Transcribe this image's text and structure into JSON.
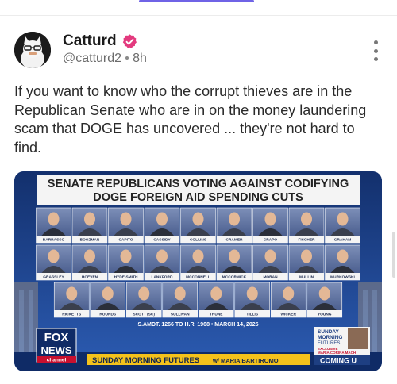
{
  "post": {
    "author_name": "Catturd",
    "handle": "@catturd2",
    "time": "8h",
    "text": "If you want to know who the corrupt thieves are in the Republican Senate who are in on the money laundering scam that DOGE has uncovered ... they're not hard to find."
  },
  "media": {
    "headline_line1": "SENATE REPUBLICANS VOTING AGAINST CODIFYING",
    "headline_line2": "DOGE FOREIGN AID SPENDING CUTS",
    "senators_row1": [
      "BARRASSO",
      "BOOZMAN",
      "CAPITO",
      "CASSIDY",
      "COLLINS",
      "CRAMER",
      "CRAPO",
      "FISCHER",
      "GRAHAM"
    ],
    "senators_row2": [
      "GRASSLEY",
      "HOEVEN",
      "HYDE-SMITH",
      "LANKFORD",
      "MCCONNELL",
      "MCCORMICK",
      "MORAN",
      "MULLIN",
      "MURKOWSKI"
    ],
    "senators_row3": [
      "RICKETTS",
      "ROUNDS",
      "SCOTT (SC)",
      "SULLIVAN",
      "THUNE",
      "TILLIS",
      "WICKER",
      "YOUNG"
    ],
    "footnote": "S.AMDT. 1266 TO H.R. 1968 • MARCH 14, 2025",
    "logo_text1": "FOX",
    "logo_text2": "NEWS",
    "logo_text3": "channel",
    "ticker_show": "SUNDAY MORNING FUTURES",
    "ticker_host": "w/ MARIA BARTIROMO",
    "promo_line1": "SUNDAY",
    "promo_line2": "MORNING",
    "promo_line3": "FUTURES",
    "promo_tag1": "EXCLUSIVE",
    "promo_tag2": "MARIA CORINA MACH",
    "promo_coming": "COMING U"
  },
  "colors": {
    "accent": "#6f63e6",
    "verified": "#e33a7e",
    "media_background": "#1e3f82",
    "ticker_yellow": "#f4c21b"
  }
}
